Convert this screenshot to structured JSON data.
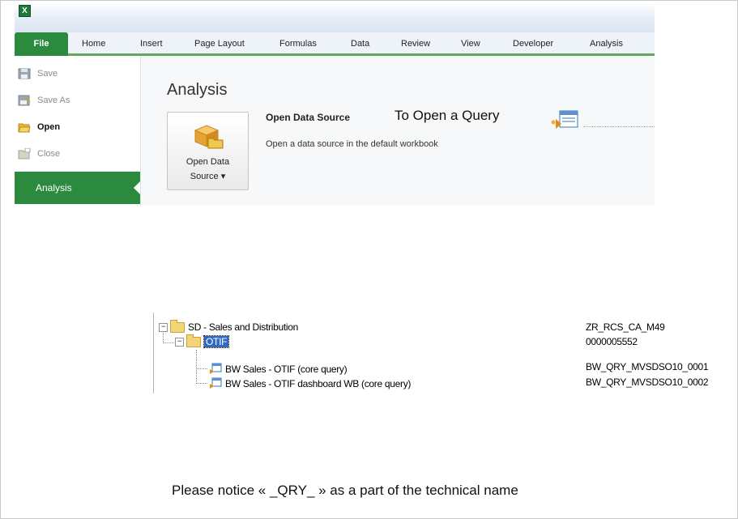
{
  "ribbon": {
    "tabs": [
      "File",
      "Home",
      "Insert",
      "Page Layout",
      "Formulas",
      "Data",
      "Review",
      "View",
      "Developer",
      "Analysis"
    ]
  },
  "backstage": {
    "items": [
      {
        "label": "Save",
        "icon": "save-icon",
        "enabled": false
      },
      {
        "label": "Save As",
        "icon": "save-as-icon",
        "enabled": false
      },
      {
        "label": "Open",
        "icon": "open-folder-icon",
        "enabled": true
      },
      {
        "label": "Close",
        "icon": "close-folder-icon",
        "enabled": false
      }
    ],
    "selected": "Analysis"
  },
  "analysis": {
    "heading": "Analysis",
    "button_line1": "Open Data",
    "button_line2": "Source ▾",
    "title": "Open Data Source",
    "description": "Open a data source in the default workbook"
  },
  "annotation": {
    "to_open": "To Open a Query",
    "notice": "Please notice « _QRY_ » as a part of the technical name"
  },
  "tree": {
    "nodes": [
      {
        "label": "SD - Sales and Distribution",
        "tech": "ZR_RCS_CA_M49",
        "type": "folder",
        "toggle": "−"
      },
      {
        "label": "OTIF",
        "tech": "0000005552",
        "type": "folder",
        "toggle": "−",
        "selected": true
      },
      {
        "label": "BW Sales - OTIF (core query)",
        "tech": "BW_QRY_MVSDSO10_0001",
        "type": "query"
      },
      {
        "label": "BW Sales - OTIF dashboard WB (core query)",
        "tech": "BW_QRY_MVSDSO10_0002",
        "type": "query"
      }
    ]
  },
  "colors": {
    "file_tab": "#2b8a3e",
    "selection": "#316ac5"
  }
}
